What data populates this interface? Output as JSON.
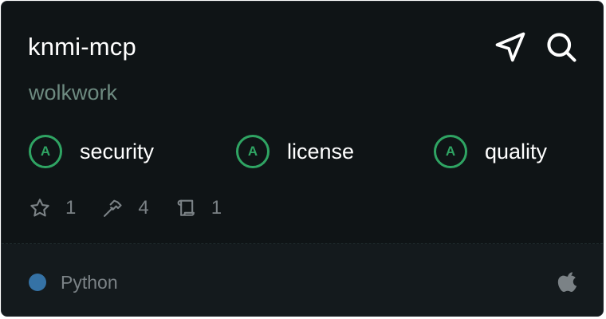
{
  "card": {
    "title": "knmi-mcp",
    "author": "wolkwork",
    "actions": [
      {
        "icon": "send-icon"
      },
      {
        "icon": "search-icon"
      }
    ],
    "badges": [
      {
        "grade": "A",
        "label": "security"
      },
      {
        "grade": "A",
        "label": "license"
      },
      {
        "grade": "A",
        "label": "quality"
      }
    ],
    "stats": [
      {
        "icon": "star-icon",
        "value": "1"
      },
      {
        "icon": "hammer-icon",
        "value": "4"
      },
      {
        "icon": "scroll-icon",
        "value": "1"
      }
    ],
    "footer": {
      "language": "Python",
      "language_color": "#3572a5",
      "platform_icon": "apple-icon"
    }
  },
  "colors": {
    "background": "#0f1416",
    "footer_background": "#141a1d",
    "badge_green": "#2fa463",
    "author": "#6d8a80",
    "muted": "#7b8286"
  }
}
